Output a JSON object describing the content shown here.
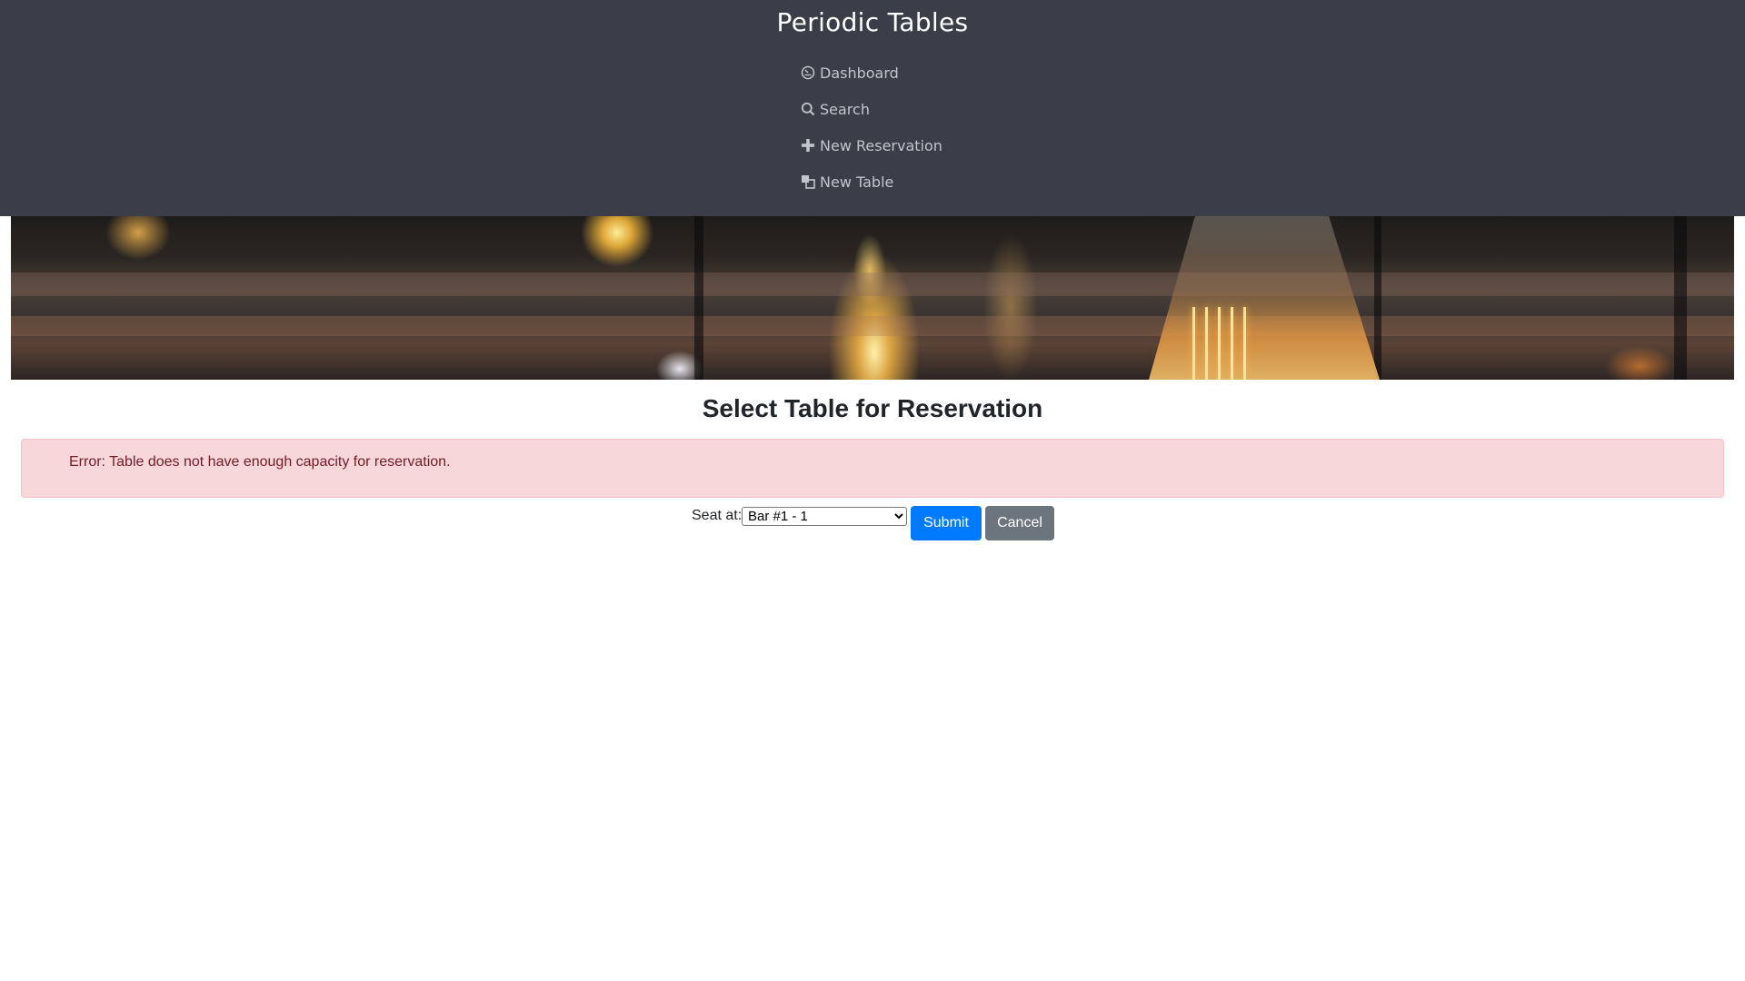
{
  "app": {
    "title": "Periodic Tables"
  },
  "nav": {
    "items": [
      {
        "label": "Dashboard",
        "icon": "dashboard-icon"
      },
      {
        "label": "Search",
        "icon": "search-icon"
      },
      {
        "label": "New Reservation",
        "icon": "plus-icon"
      },
      {
        "label": "New Table",
        "icon": "table-icon"
      }
    ]
  },
  "page": {
    "title": "Select Table for Reservation"
  },
  "alert": {
    "message": "Error: Table does not have enough capacity for reservation."
  },
  "form": {
    "seat_label": "Seat at:",
    "selected_table": "Bar #1 - 1",
    "submit_label": "Submit",
    "cancel_label": "Cancel"
  },
  "colors": {
    "header_bg": "#3b3d48",
    "nav_text": "#c3c5cd",
    "alert_bg": "#f8d7da",
    "alert_text": "#721c24",
    "primary": "#007bff",
    "secondary": "#6c757d"
  }
}
